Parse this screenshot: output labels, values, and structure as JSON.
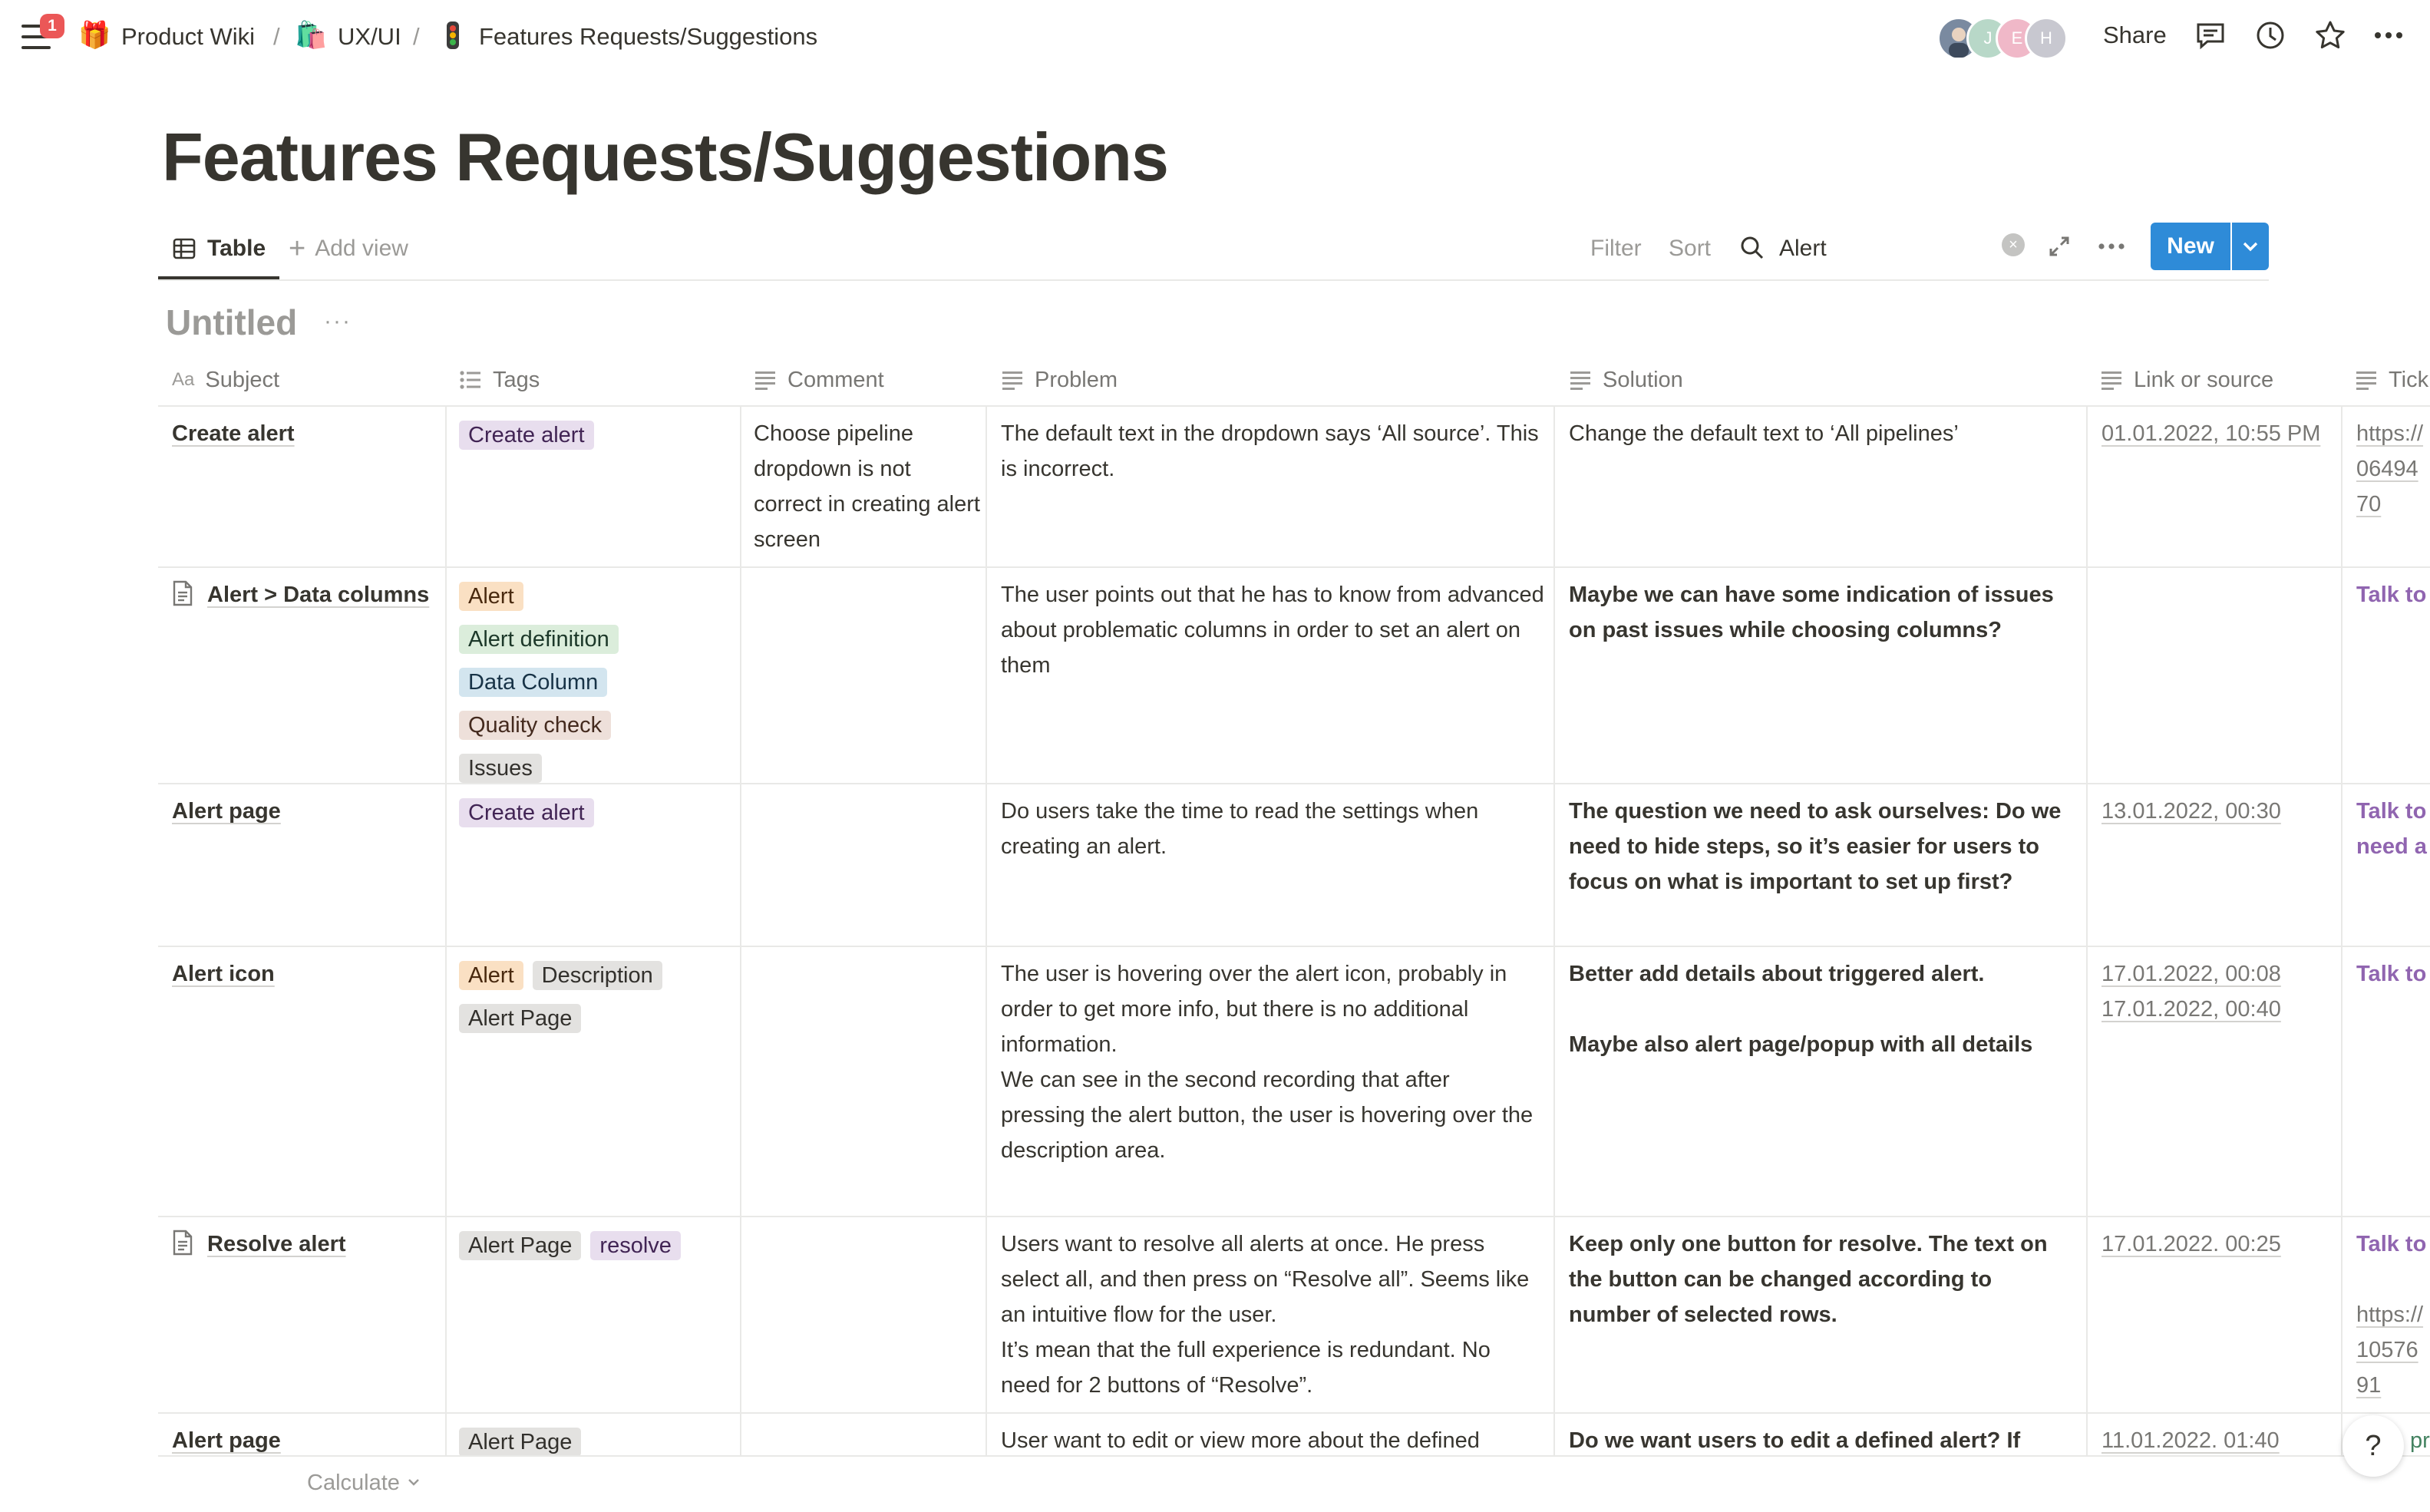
{
  "notifications": {
    "count": "1"
  },
  "breadcrumb": [
    {
      "label": "Product Wiki",
      "icon": "gift-icon"
    },
    {
      "label": "UX/UI",
      "icon": "shopping-bags-icon"
    },
    {
      "label": "Features Requests/Suggestions",
      "icon": "traffic-light-icon"
    }
  ],
  "breadcrumb_separator": "/",
  "collaborators": [
    {
      "initial": "",
      "color": "#7a8aa0"
    },
    {
      "initial": "J",
      "color": "#b8d8c8"
    },
    {
      "initial": "E",
      "color": "#f0b8c8"
    },
    {
      "initial": "H",
      "color": "#c8c8d0"
    }
  ],
  "top_actions": {
    "share": "Share"
  },
  "page": {
    "title": "Features Requests/Suggestions"
  },
  "views": {
    "active": "Table",
    "add_view": "Add view"
  },
  "toolbar": {
    "filter": "Filter",
    "sort": "Sort",
    "search_value": "Alert",
    "clear": "×",
    "new_label": "New"
  },
  "group": {
    "title": "Untitled",
    "more": "···"
  },
  "columns": [
    {
      "label": "Subject",
      "icon": "title-icon"
    },
    {
      "label": "Tags",
      "icon": "multi-select-icon"
    },
    {
      "label": "Comment",
      "icon": "text-property-icon"
    },
    {
      "label": "Problem",
      "icon": "text-property-icon"
    },
    {
      "label": "Solution",
      "icon": "text-property-icon"
    },
    {
      "label": "Link or source",
      "icon": "text-property-icon"
    },
    {
      "label": "Tick",
      "icon": "text-property-icon"
    }
  ],
  "rows": [
    {
      "subject": "Create alert",
      "tags": [
        "Create alert"
      ],
      "comment": "Choose pipeline dropdown is not correct in creating alert screen",
      "problem": "The default text in the dropdown says ‘All source’. This is incorrect.",
      "solution": "Change the default text to ‘All pipelines’",
      "link": "01.01.2022, 10:55 PM",
      "ticket": "https://06494 70"
    },
    {
      "subject": "Alert > Data columns",
      "tags": [
        "Alert",
        "Alert definition",
        "Data Column",
        "Quality check",
        "Issues"
      ],
      "comment": "",
      "problem": "The user points out that he has to know from advanced about problematic columns in order to set an alert on them",
      "solution": "Maybe we can have some indication of issues on past issues while choosing columns?",
      "link": "",
      "ticket": "Talk to"
    },
    {
      "subject": "Alert page",
      "tags": [
        "Create alert"
      ],
      "comment": "",
      "problem": "Do users take the time to read the settings when creating an alert.",
      "solution": "The question we need to ask ourselves: Do we need to hide steps, so it’s easier for users to focus on what is important to set up first?",
      "link": "13.01.2022, 00:30",
      "ticket": "Talk to need a"
    },
    {
      "subject": "Alert icon",
      "tags": [
        "Alert",
        "Description",
        "Alert Page"
      ],
      "comment": "",
      "problem": "The user is hovering over the alert icon, probably in order to get more info, but there is no additional information.\nWe can see in the second recording that after pressing the alert button, the user is hovering over the description area.",
      "solution": "Better add details about triggered alert.\n\nMaybe also alert page/popup with all details",
      "link": "17.01.2022, 00:08\n17.01.2022, 00:40",
      "ticket": "Talk to"
    },
    {
      "subject": "Resolve alert",
      "tags": [
        "Alert Page",
        "resolve"
      ],
      "comment": "",
      "problem": "Users want to resolve all alerts at once. He press select all, and then press on “Resolve all”. Seems like an intuitive flow for the user.\nIt’s mean that the full experience is redundant. No need for 2 buttons of “Resolve”.",
      "solution": "Keep only one button for resolve. The text on the button can be changed according to number of selected rows.",
      "link": "17.01.2022. 00:25",
      "ticket_talk": "Talk to",
      "ticket_link": "https://10576 91"
    },
    {
      "subject": "Alert page",
      "tags": [
        "Alert Page"
      ],
      "comment": "",
      "problem": "User want to edit or view more about the defined",
      "solution": "Do we want users to edit a defined alert? If",
      "link": "11.01.2022. 01:40",
      "ticket": "pr"
    }
  ],
  "tag_colors": {
    "Create alert": "purple",
    "Alert": "orange",
    "Alert definition": "green",
    "Data Column": "blue",
    "Quality check": "brown",
    "Issues": "gray",
    "Description": "gray",
    "Alert Page": "gray",
    "resolve": "purple"
  },
  "footer": {
    "calculate": "Calculate"
  },
  "help": {
    "label": "?"
  }
}
